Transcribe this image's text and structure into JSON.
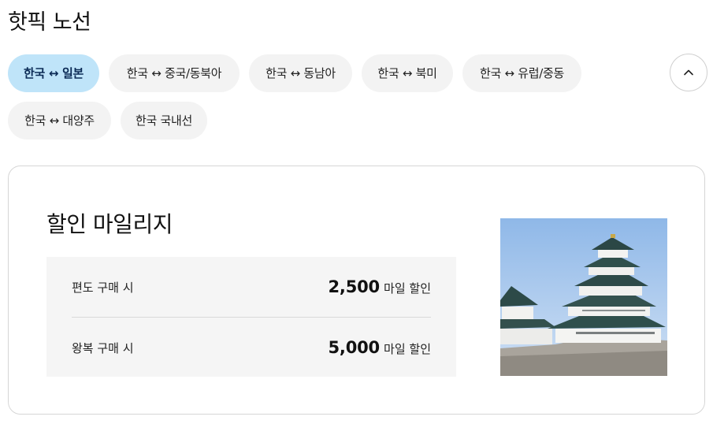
{
  "section": {
    "title": "핫픽 노선"
  },
  "route_tabs": [
    {
      "label": "한국 ↔ 일본",
      "active": true
    },
    {
      "label": "한국 ↔ 중국/동북아",
      "active": false
    },
    {
      "label": "한국 ↔ 동남아",
      "active": false
    },
    {
      "label": "한국 ↔ 북미",
      "active": false
    },
    {
      "label": "한국 ↔ 유럽/중동",
      "active": false
    },
    {
      "label": "한국 ↔ 대양주",
      "active": false
    },
    {
      "label": "한국 국내선",
      "active": false
    }
  ],
  "collapse_icon": "chevron-up-icon",
  "card": {
    "title": "할인 마일리지",
    "rows": [
      {
        "label": "편도 구매 시",
        "value": "2,500",
        "unit": "마일 할인"
      },
      {
        "label": "왕복 구매 시",
        "value": "5,000",
        "unit": "마일 할인"
      }
    ]
  },
  "colors": {
    "active_tab_bg": "#bfe4f9",
    "active_tab_text": "#0b2a55",
    "tab_bg": "#f3f3f3",
    "mile_box_bg": "#f5f5f5"
  }
}
